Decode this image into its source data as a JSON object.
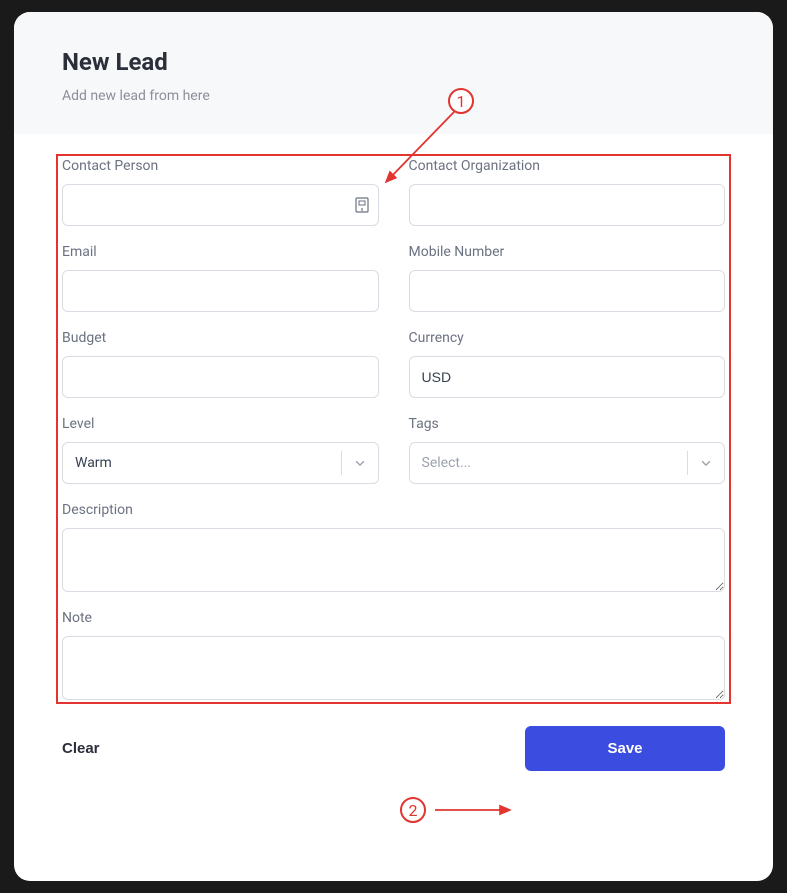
{
  "header": {
    "title": "New Lead",
    "subtitle": "Add new lead from here"
  },
  "fields": {
    "contact_person": {
      "label": "Contact Person",
      "value": ""
    },
    "contact_organization": {
      "label": "Contact Organization",
      "value": ""
    },
    "email": {
      "label": "Email",
      "value": ""
    },
    "mobile_number": {
      "label": "Mobile Number",
      "value": ""
    },
    "budget": {
      "label": "Budget",
      "value": ""
    },
    "currency": {
      "label": "Currency",
      "value": "USD"
    },
    "level": {
      "label": "Level",
      "value": "Warm"
    },
    "tags": {
      "label": "Tags",
      "placeholder": "Select..."
    },
    "description": {
      "label": "Description",
      "value": ""
    },
    "note": {
      "label": "Note",
      "value": ""
    }
  },
  "footer": {
    "clear": "Clear",
    "save": "Save"
  },
  "annotations": {
    "badge1": "1",
    "badge2": "2"
  }
}
